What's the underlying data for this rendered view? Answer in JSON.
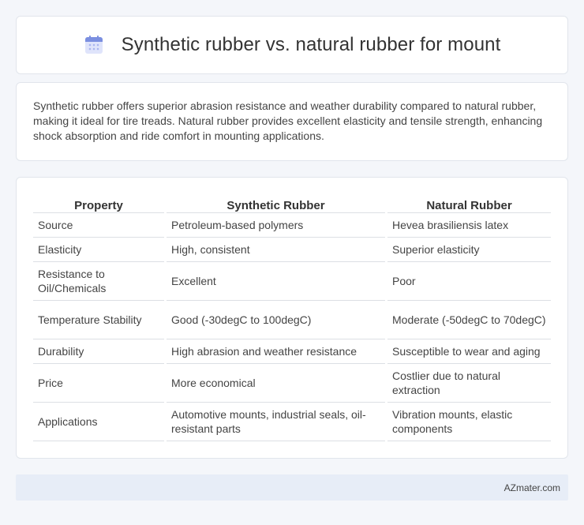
{
  "header": {
    "title": "Synthetic rubber vs. natural rubber for mount",
    "icon": "calendar-icon"
  },
  "summary": "Synthetic rubber offers superior abrasion resistance and weather durability compared to natural rubber, making it ideal for tire treads. Natural rubber provides excellent elasticity and tensile strength, enhancing shock absorption and ride comfort in mounting applications.",
  "table": {
    "headers": [
      "Property",
      "Synthetic Rubber",
      "Natural Rubber"
    ],
    "rows": [
      [
        "Source",
        "Petroleum-based polymers",
        "Hevea brasiliensis latex"
      ],
      [
        "Elasticity",
        "High, consistent",
        "Superior elasticity"
      ],
      [
        "Resistance to Oil/Chemicals",
        "Excellent",
        "Poor"
      ],
      [
        "Temperature Stability",
        "Good (-30degC to 100degC)",
        "Moderate (-50degC to 70degC)"
      ],
      [
        "Durability",
        "High abrasion and weather resistance",
        "Susceptible to wear and aging"
      ],
      [
        "Price",
        "More economical",
        "Costlier due to natural extraction"
      ],
      [
        "Applications",
        "Automotive mounts, industrial seals, oil-resistant parts",
        "Vibration mounts, elastic components"
      ]
    ]
  },
  "footer": {
    "brand": "AZmater.com"
  },
  "colors": {
    "accent": "#7b8fe0",
    "footer_bg": "#e7edf7"
  }
}
